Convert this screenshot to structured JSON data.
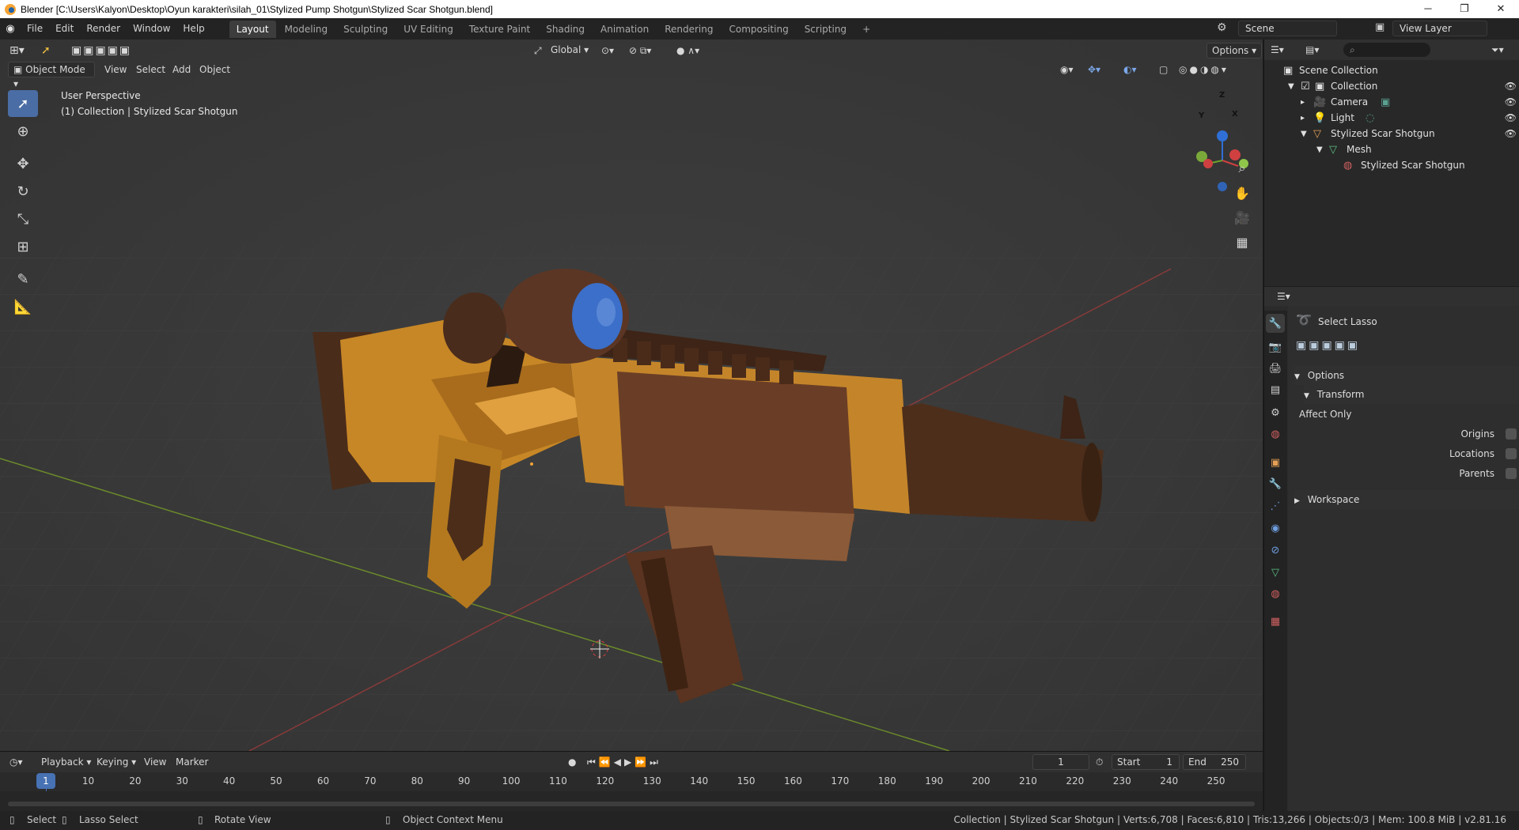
{
  "window": {
    "title": "Blender [C:\\Users\\Kalyon\\Desktop\\Oyun karakteri\\silah_01\\Stylized Pump Shotgun\\Stylized Scar Shotgun.blend]",
    "minimize": "─",
    "restore": "❐",
    "close": "✕"
  },
  "menubar": {
    "items": [
      "File",
      "Edit",
      "Render",
      "Window",
      "Help"
    ]
  },
  "workspaces": [
    "Layout",
    "Modeling",
    "Sculpting",
    "UV Editing",
    "Texture Paint",
    "Shading",
    "Animation",
    "Rendering",
    "Compositing",
    "Scripting"
  ],
  "workspace_add": "+",
  "scene": {
    "name": "Scene",
    "view_layer": "View Layer"
  },
  "viewport": {
    "mode": "Object Mode",
    "menu": [
      "View",
      "Select",
      "Add",
      "Object"
    ],
    "orientation": "Global",
    "options_label": "Options",
    "info_line1": "User Perspective",
    "info_line2": "(1) Collection | Stylized Scar Shotgun"
  },
  "gizmo": {
    "x": "X",
    "y": "Y",
    "z": "Z"
  },
  "timeline": {
    "menu": [
      "Playback",
      "Keying",
      "View",
      "Marker"
    ],
    "current_frame": "1",
    "start_label": "Start",
    "start": "1",
    "end_label": "End",
    "end": "250",
    "ticks": [
      "10",
      "20",
      "30",
      "40",
      "50",
      "60",
      "70",
      "80",
      "90",
      "100",
      "110",
      "120",
      "130",
      "140",
      "150",
      "160",
      "170",
      "180",
      "190",
      "200",
      "210",
      "220",
      "230",
      "240",
      "250"
    ]
  },
  "statusbar": {
    "select": "Select",
    "lasso": "Lasso Select",
    "rotate": "Rotate View",
    "context": "Object Context Menu",
    "stats": "Collection | Stylized Scar Shotgun | Verts:6,708 | Faces:6,810 | Tris:13,266 | Objects:0/3 | Mem: 100.8 MiB | v2.81.16"
  },
  "outliner": {
    "rows": [
      {
        "label": "Scene Collection"
      },
      {
        "label": "Collection"
      },
      {
        "label": "Camera"
      },
      {
        "label": "Light"
      },
      {
        "label": "Stylized Scar Shotgun"
      },
      {
        "label": "Mesh"
      },
      {
        "label": "Stylized Scar Shotgun"
      }
    ]
  },
  "properties": {
    "tool_name": "Select Lasso",
    "options": "Options",
    "transform": "Transform",
    "affect_only": "Affect Only",
    "origins": "Origins",
    "locations": "Locations",
    "parents": "Parents",
    "workspace": "Workspace"
  },
  "colors": {
    "accent": "#4772b3",
    "gun_orange": "#c98a2a",
    "gun_brown": "#5a3520",
    "scope_blue": "#3b6fc9"
  }
}
